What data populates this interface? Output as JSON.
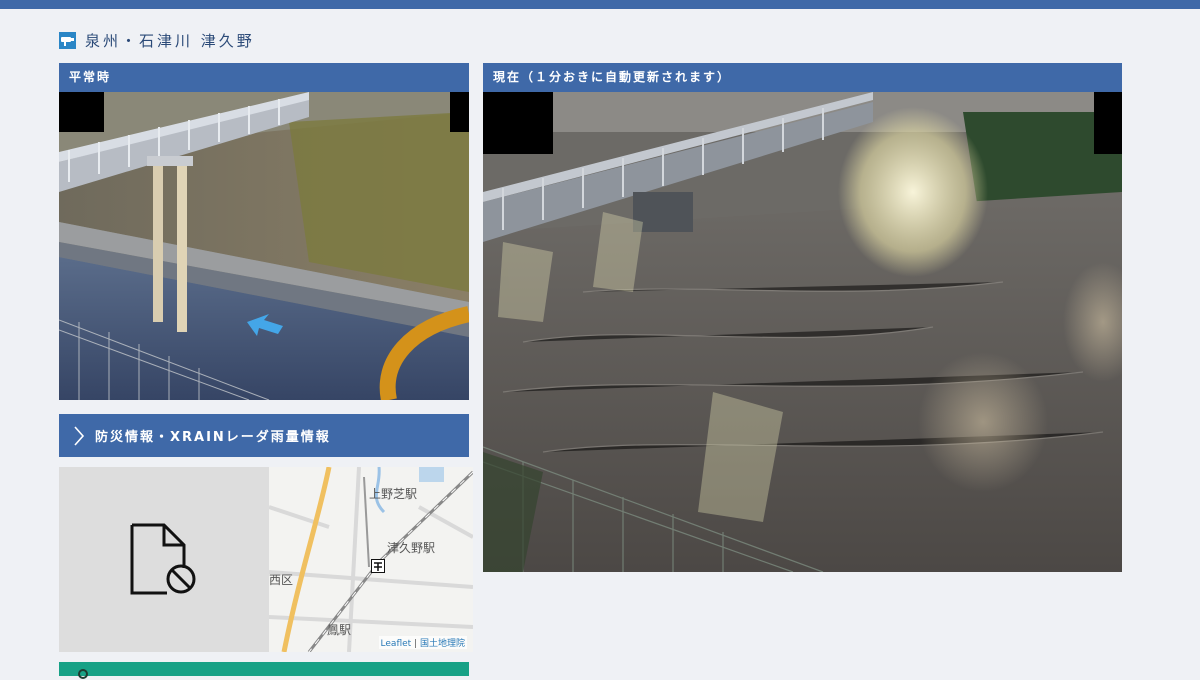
{
  "header": {
    "title": "泉州・石津川 津久野",
    "accent_color": "#3f69a8"
  },
  "normal_panel": {
    "label": "平常時"
  },
  "current_panel": {
    "label": "現在（１分おきに自動更新されます）"
  },
  "disaster_link": {
    "label": "防災情報・XRAINレーダ雨量情報",
    "icon": "chevron-right-icon"
  },
  "broken_image": {
    "icon": "file-blocked-icon"
  },
  "map": {
    "labels": {
      "station_1": "上野芝駅",
      "station_2": "津久野駅",
      "ward": "西区",
      "station_3": "鳳駅"
    },
    "marker_icon": "camera-marker-icon",
    "attribution": {
      "leaflet": "Leaflet",
      "separator": "|",
      "gsi": "国土地理院"
    }
  },
  "bottom_bar": {
    "icon": "location-icon",
    "color": "#17a186"
  }
}
